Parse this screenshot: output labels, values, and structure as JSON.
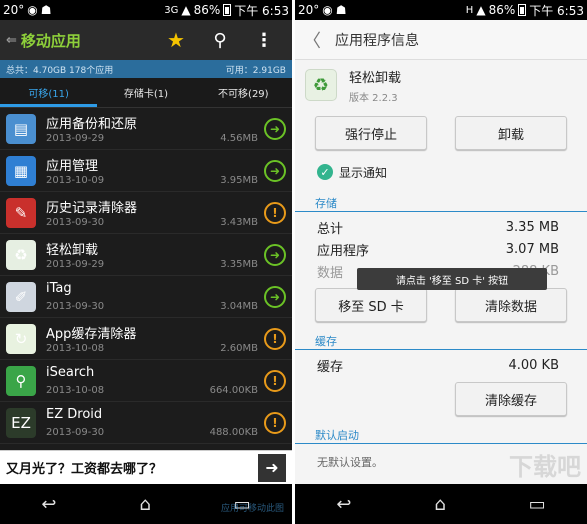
{
  "left_status": {
    "temp": "20°",
    "signal": "3G",
    "battery": "86%",
    "time": "下午 6:53"
  },
  "left_header": {
    "back": "⇐",
    "title": "移动应用"
  },
  "summary": {
    "total": "总共：4.70GB 178个应用",
    "available": "可用：2.91GB"
  },
  "tabs": [
    "可移(11)",
    "存储卡(1)",
    "不可移(29)"
  ],
  "apps": [
    {
      "name": "应用备份和还原",
      "date": "2013-09-29",
      "size": "4.56MB",
      "icon": "backup-icon",
      "color": "#4a8fd0",
      "glyph": "▤",
      "action": "go"
    },
    {
      "name": "应用管理",
      "date": "2013-10-09",
      "size": "3.95MB",
      "icon": "app-manager-icon",
      "color": "#2f7fd3",
      "glyph": "▦",
      "action": "go"
    },
    {
      "name": "历史记录清除器",
      "date": "2013-09-30",
      "size": "3.43MB",
      "icon": "history-eraser-icon",
      "color": "#c9302c",
      "glyph": "✎",
      "action": "warn"
    },
    {
      "name": "轻松卸载",
      "date": "2013-09-29",
      "size": "3.35MB",
      "icon": "recycle-icon",
      "color": "#e6efe2",
      "glyph": "♻",
      "action": "go"
    },
    {
      "name": "iTag",
      "date": "2013-09-30",
      "size": "3.04MB",
      "icon": "itag-icon",
      "color": "#cfd6df",
      "glyph": "✐",
      "action": "go"
    },
    {
      "name": "App缓存清除器",
      "date": "2013-10-08",
      "size": "2.60MB",
      "icon": "cache-cleaner-icon",
      "color": "#e8f2e0",
      "glyph": "↻",
      "action": "warn"
    },
    {
      "name": "iSearch",
      "date": "2013-10-08",
      "size": "664.00KB",
      "icon": "search-app-icon",
      "color": "#3aa548",
      "glyph": "⚲",
      "action": "warn"
    },
    {
      "name": "EZ Droid",
      "date": "2013-09-30",
      "size": "488.00KB",
      "icon": "ez-droid-icon",
      "color": "#2c3b2a",
      "glyph": "EZ",
      "action": "warn"
    }
  ],
  "ad": {
    "text": "又月光了？工资都去哪了？",
    "arrow": "➜"
  },
  "hint": "应用可移动此图",
  "right_status": {
    "temp": "20°",
    "signal": "H",
    "battery": "86%",
    "time": "下午 6:53"
  },
  "right_header": {
    "back": "〈",
    "title": "应用程序信息"
  },
  "app": {
    "name": "轻松卸载",
    "version": "版本 2.2.3"
  },
  "buttons": {
    "force_stop": "强行停止",
    "uninstall": "卸载",
    "move_sd": "移至 SD 卡",
    "clear_data": "清除数据",
    "clear_cache": "清除缓存"
  },
  "notify": "显示通知",
  "storage": {
    "title": "存储",
    "rows": [
      {
        "k": "总计",
        "v": "3.35 MB"
      },
      {
        "k": "应用程序",
        "v": "3.07 MB"
      },
      {
        "k": "数据",
        "v": "288 KB"
      }
    ]
  },
  "toast": "请点击 '移至 SD 卡' 按钮",
  "cache": {
    "title": "缓存",
    "label": "缓存",
    "value": "4.00 KB"
  },
  "default": {
    "title": "默认启动",
    "text": "无默认设置。"
  },
  "watermark": "下载吧"
}
